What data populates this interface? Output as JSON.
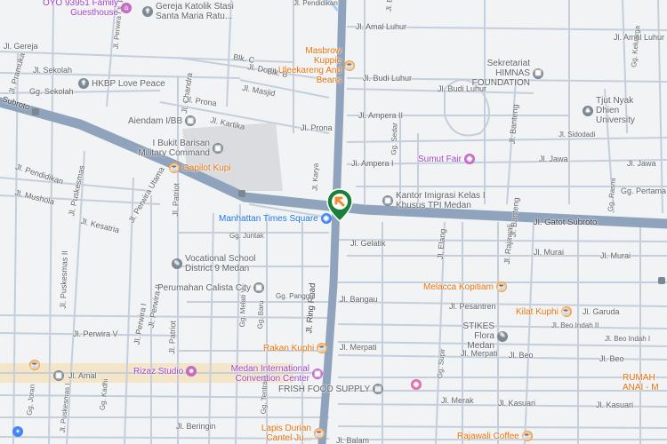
{
  "map": {
    "colors": {
      "background": "#f1f3f4",
      "major_road": "#8fa3bd",
      "minor_road": "#c5cfdb",
      "block": "#dadce0",
      "beach_strip": "#f4e5c7",
      "marker_green": "#188038",
      "marker_arrow": "#f28b2e"
    },
    "roads": [
      {
        "label": "Jl. Gatot Subroto"
      },
      {
        "label": "Subroto"
      },
      {
        "label": "Jl. Ring Road"
      },
      {
        "label": "Jl. Amal Luhur"
      },
      {
        "label": "Jl. Amal Luhur"
      },
      {
        "label": "Jl. Budi Luhur"
      },
      {
        "label": "Jl. Budi Luhur"
      },
      {
        "label": "Jl. Ampera II"
      },
      {
        "label": "Jl. Ampera I"
      },
      {
        "label": "Jl. Prona"
      },
      {
        "label": "Jl. Prona"
      },
      {
        "label": "Jl. Kartika"
      },
      {
        "label": "Jl. Masjid"
      },
      {
        "label": "Jl. Dodik"
      },
      {
        "label": "Blk. C"
      },
      {
        "label": "Blk. B"
      },
      {
        "label": "Jl. Gereja"
      },
      {
        "label": "Jl. Sekolah"
      },
      {
        "label": "Gg. Sekolah"
      },
      {
        "label": "Jl. Pramuka"
      },
      {
        "label": "Jl. Pendidikan"
      },
      {
        "label": "Jl. Mushola"
      },
      {
        "label": "Jl. Puskesmas"
      },
      {
        "label": "Jl. Perwira Utama"
      },
      {
        "label": "Jl. Kesatria"
      },
      {
        "label": "Jl. Patriot"
      },
      {
        "label": "Jl. Patriot"
      },
      {
        "label": "Jl. Puskesmas II"
      },
      {
        "label": "Jl. Perwira I"
      },
      {
        "label": "Jl. Perwira II"
      },
      {
        "label": "Jl. Perwira V"
      },
      {
        "label": "Gg. Juntak"
      },
      {
        "label": "Jl. Gelatik"
      },
      {
        "label": "Jl. Bangau"
      },
      {
        "label": "Jl. Pesantren"
      },
      {
        "label": "Jl. Murai"
      },
      {
        "label": "Jl. Murai"
      },
      {
        "label": "Jl. Garuda"
      },
      {
        "label": "Jl. Beo Indah I"
      },
      {
        "label": "Jl. Beo Indah II"
      },
      {
        "label": "Jl. Beo"
      },
      {
        "label": "Jl. Beo"
      },
      {
        "label": "Jl. Merpati"
      },
      {
        "label": "Jl. Merpati"
      },
      {
        "label": "Jl. Merak"
      },
      {
        "label": "Jl. Kasuari"
      },
      {
        "label": "Jl. Kasuari"
      },
      {
        "label": "Jl. Beringin"
      },
      {
        "label": "Jl. Balam"
      },
      {
        "label": "Jl. Amal"
      },
      {
        "label": "Jl. Jawa"
      },
      {
        "label": "Jl. Jawa"
      },
      {
        "label": "Gg. Pertama"
      },
      {
        "label": "Jl. Rajawali"
      },
      {
        "label": "Jl. Elang"
      },
      {
        "label": "Jl. Banteng"
      },
      {
        "label": "Jl. Banteng"
      },
      {
        "label": "Gg. Rasmi"
      },
      {
        "label": "Gg. Keluarga"
      },
      {
        "label": "Jl. Sidodadi"
      },
      {
        "label": "Gg. Panggul"
      },
      {
        "label": "Gg. Melati V"
      },
      {
        "label": "Gg. Baru"
      },
      {
        "label": "Gg. Tentram"
      },
      {
        "label": "Gg. Supir"
      },
      {
        "label": "Gg. Sedar"
      },
      {
        "label": "Jl. Chandra"
      },
      {
        "label": "Jl. Pendidikan"
      },
      {
        "label": "Jl. Perwira I"
      },
      {
        "label": "Jl. Karya"
      },
      {
        "label": "Gg. Joran"
      },
      {
        "label": "Jl. Puskesmas I"
      },
      {
        "label": "Gg. Kadhi"
      },
      {
        "label": "Jl. Pi"
      },
      {
        "label": "Jl. Bl"
      }
    ],
    "places": [
      {
        "name": "OYO 93951 Family Guesthouse",
        "icon": "hotel-icon",
        "style": "purple"
      },
      {
        "name": "Gereja Katolik Stasi Santa Maria Ratu...",
        "icon": "church-icon",
        "style": "gray"
      },
      {
        "name": "Masbrow Kuppie Uleekareng And Beans",
        "icon": "cafe-icon",
        "style": "orange"
      },
      {
        "name": "Sekretariat HIMNAS FOUNDATION",
        "icon": "building-icon",
        "style": "gray"
      },
      {
        "name": "HKBP Love Peace",
        "icon": "church-icon",
        "style": "gray"
      },
      {
        "name": "Tjut Nyak Dhien University",
        "icon": "university-icon",
        "style": "gray"
      },
      {
        "name": "Aiendam I/BB",
        "icon": "building-icon",
        "style": "gray"
      },
      {
        "name": "I Bukit Barisan Military Command",
        "icon": "building-icon",
        "style": "gray"
      },
      {
        "name": "Gapilot Kupi",
        "icon": "cafe-icon",
        "style": "orange"
      },
      {
        "name": "Sumut Fair",
        "icon": "shopping-icon",
        "style": "purple"
      },
      {
        "name": "Kantor Imigrasi Kelas I Khusus TPI Medan",
        "icon": "building-icon",
        "style": "gray"
      },
      {
        "name": "Manhattan Times Square",
        "icon": "shopping-icon",
        "style": "blue"
      },
      {
        "name": "Vocational School District 9 Medan",
        "icon": "school-icon",
        "style": "gray"
      },
      {
        "name": "Perumahan Calista City",
        "icon": "building-icon",
        "style": "gray"
      },
      {
        "name": "Melacca Kopitiam",
        "icon": "cafe-icon",
        "style": "orange"
      },
      {
        "name": "Kilat Kuphi",
        "icon": "cafe-icon",
        "style": "orange"
      },
      {
        "name": "STIKES Flora Medan",
        "icon": "school-icon",
        "style": "gray"
      },
      {
        "name": "Rakan Kuphi",
        "icon": "cafe-icon",
        "style": "orange"
      },
      {
        "name": "Rizaz Studio",
        "icon": "camera-icon",
        "style": "purple"
      },
      {
        "name": "Medan International Convention Center",
        "icon": "building-icon",
        "style": "purple"
      },
      {
        "name": "FRISH FOOD SUPPLY",
        "icon": "store-icon",
        "style": "gray"
      },
      {
        "name": "Rajawali Coffee",
        "icon": "cafe-icon",
        "style": "orange"
      },
      {
        "name": "Lapis Durian Cantel Ju...",
        "icon": "cafe-icon",
        "style": "orange"
      },
      {
        "name": "RUMAH ANAI - M",
        "icon": "building-icon",
        "style": "orange"
      }
    ]
  }
}
